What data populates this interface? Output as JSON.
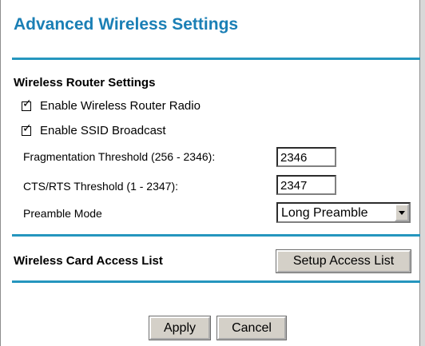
{
  "page": {
    "title": "Advanced Wireless Settings"
  },
  "router_settings": {
    "heading": "Wireless Router Settings",
    "enable_radio": {
      "label": "Enable Wireless Router Radio",
      "checked": true
    },
    "enable_ssid": {
      "label": "Enable SSID Broadcast",
      "checked": true
    },
    "fragmentation": {
      "label": "Fragmentation Threshold (256 - 2346):",
      "value": "2346"
    },
    "cts_rts": {
      "label": "CTS/RTS Threshold (1 - 2347):",
      "value": "2347"
    },
    "preamble": {
      "label": "Preamble Mode",
      "value": "Long Preamble"
    }
  },
  "access_list": {
    "heading": "Wireless Card Access List",
    "button_label": "Setup Access List"
  },
  "actions": {
    "apply_label": "Apply",
    "cancel_label": "Cancel"
  },
  "colors": {
    "title": "#1a7fb5",
    "divider": "#2596be",
    "button_face": "#d4d0c8"
  },
  "icons": {
    "checkbox_check": "check-icon",
    "dropdown": "chevron-down-icon"
  }
}
